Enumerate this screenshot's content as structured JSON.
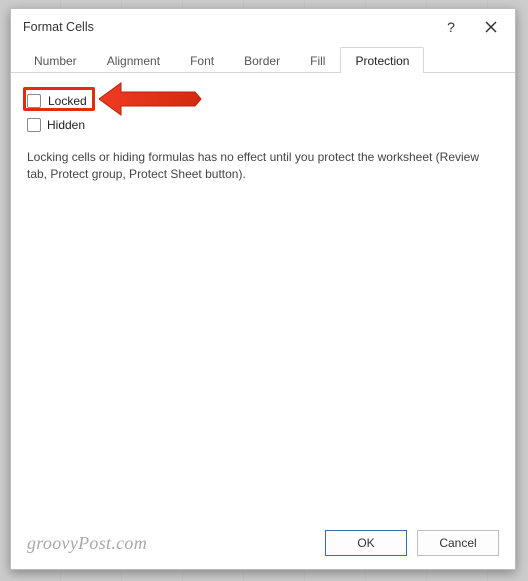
{
  "dialog": {
    "title": "Format Cells"
  },
  "tabs": {
    "number": "Number",
    "alignment": "Alignment",
    "font": "Font",
    "border": "Border",
    "fill": "Fill",
    "protection": "Protection"
  },
  "protection": {
    "locked_label": "Locked",
    "hidden_label": "Hidden",
    "locked_checked": false,
    "hidden_checked": false,
    "note": "Locking cells or hiding formulas has no effect until you protect the worksheet (Review tab, Protect group, Protect Sheet button)."
  },
  "footer": {
    "ok": "OK",
    "cancel": "Cancel"
  },
  "watermark": "groovyPost.com",
  "annotations": {
    "highlight_color": "#e22c0f",
    "arrow_color": "#ee3a24"
  }
}
